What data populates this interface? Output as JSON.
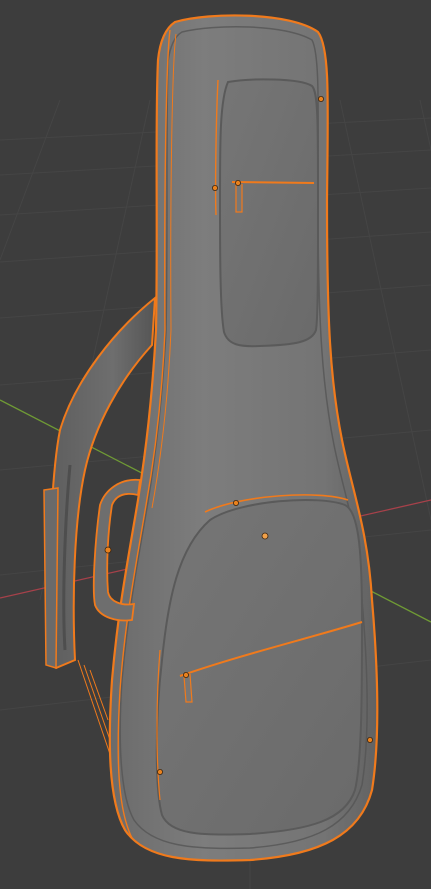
{
  "viewport": {
    "background_color": "#3d3d3d",
    "grid_color": "#454545",
    "x_axis_color": "#a7414a",
    "y_axis_color": "#6f9a35",
    "selection_color": "#f07a1c",
    "selection_highlight_color": "#ffb04a",
    "mesh_color": "#7a7a7a",
    "mesh_shadow_color": "#5a5a5a",
    "origin_dot_color": "#e9821e",
    "active_origin_dot_color": "#f0a14a"
  },
  "scene": {
    "object": "guitar-gig-bag",
    "selected": true
  }
}
